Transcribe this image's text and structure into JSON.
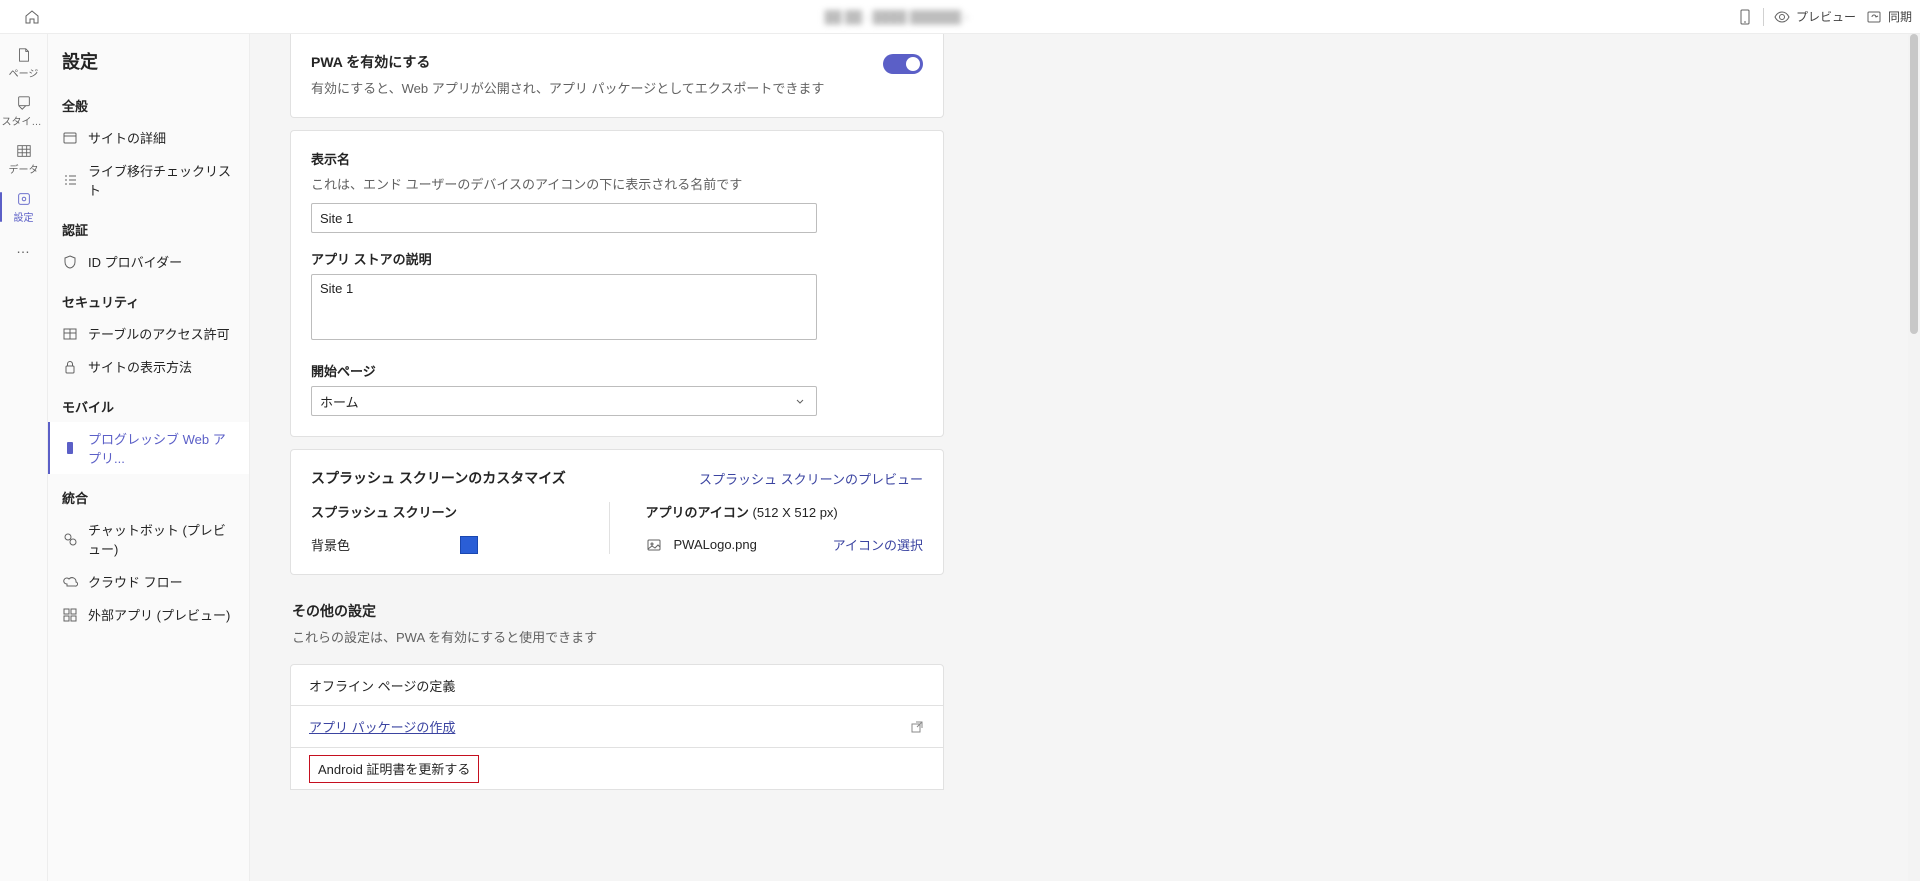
{
  "topbar": {
    "center_blur": "██ ██ - ████ ██████ ›",
    "preview": "プレビュー",
    "sync": "同期"
  },
  "rail": {
    "pages": "ページ",
    "styling": "スタイル...",
    "data": "データ",
    "settings": "設定",
    "more": "…"
  },
  "sidebar": {
    "title": "設定",
    "general": "全般",
    "site_details": "サイトの詳細",
    "golive_checklist": "ライブ移行チェックリスト",
    "auth": "認証",
    "idp": "ID プロバイダー",
    "security": "セキュリティ",
    "table_perms": "テーブルのアクセス許可",
    "site_visibility": "サイトの表示方法",
    "mobile": "モバイル",
    "pwa": "プログレッシブ Web アプリ...",
    "integration": "統合",
    "chatbot": "チャットボット (プレビュー)",
    "cloud_flow": "クラウド フロー",
    "external_apps": "外部アプリ (プレビュー)"
  },
  "pwa_card": {
    "title": "PWA を有効にする",
    "desc": "有効にすると、Web アプリが公開され、アプリ パッケージとしてエクスポートできます"
  },
  "display_card": {
    "display_name_label": "表示名",
    "display_name_desc": "これは、エンド ユーザーのデバイスのアイコンの下に表示される名前です",
    "display_name_value": "Site 1",
    "store_desc_label": "アプリ ストアの説明",
    "store_desc_value": "Site 1",
    "start_page_label": "開始ページ",
    "start_page_value": "ホーム"
  },
  "splash": {
    "title": "スプラッシュ スクリーンのカスタマイズ",
    "preview_link": "スプラッシュ スクリーンのプレビュー",
    "splash_screen": "スプラッシュ スクリーン",
    "bgcolor_label": "背景色",
    "app_icon_label": "アプリのアイコン",
    "app_icon_dims": "(512 X 512 px)",
    "icon_filename": "PWALogo.png",
    "icon_select": "アイコンの選択"
  },
  "other": {
    "header": "その他の設定",
    "desc": "これらの設定は、PWA を有効にすると使用できます",
    "offline_pages": "オフライン ページの定義",
    "create_package": "アプリ パッケージの作成",
    "android_cert": "Android 証明書を更新する"
  }
}
